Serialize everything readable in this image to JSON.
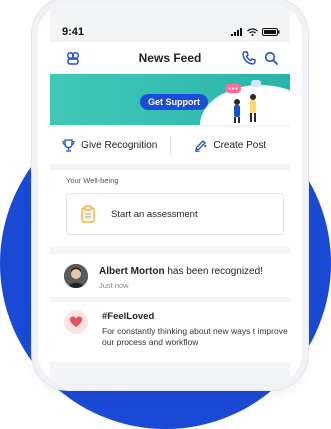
{
  "status_bar": {
    "time": "9:41"
  },
  "header": {
    "title": "News Feed"
  },
  "banner": {
    "button_label": "Get Support"
  },
  "actions": {
    "recognition_label": "Give Recognition",
    "post_label": "Create Post"
  },
  "wellbeing": {
    "section_label": "Your Well-being",
    "assessment_label": "Start an assessment"
  },
  "feed": {
    "item": {
      "name": "Albert Morton",
      "text": " has been recognized!",
      "time": "Just now"
    },
    "post": {
      "tag": "#FeelLoved",
      "body": "For constantly thinking about new ways t improve our process and workflow"
    }
  },
  "colors": {
    "accent": "#1b4ed8",
    "teal": "#2ab3aa",
    "background_circle": "#1a49d6"
  }
}
